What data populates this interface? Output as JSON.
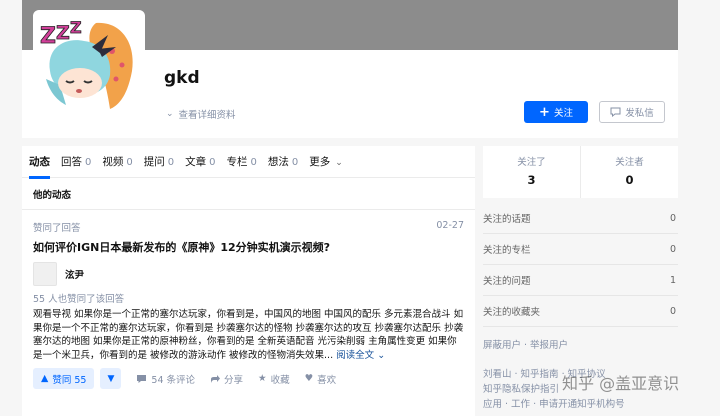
{
  "profile": {
    "name": "gkd",
    "view_details": "查看详细资料",
    "follow_label": "关注",
    "message_label": "发私信",
    "avatar_text": "ZZZ"
  },
  "tabs": [
    {
      "label": "动态",
      "count": ""
    },
    {
      "label": "回答",
      "count": "0"
    },
    {
      "label": "视频",
      "count": "0"
    },
    {
      "label": "提问",
      "count": "0"
    },
    {
      "label": "文章",
      "count": "0"
    },
    {
      "label": "专栏",
      "count": "0"
    },
    {
      "label": "想法",
      "count": "0"
    },
    {
      "label": "更多",
      "count": ""
    }
  ],
  "feed": {
    "section_title": "他的动态",
    "item": {
      "action": "赞同了回答",
      "date": "02-27",
      "title": "如何评价IGN日本最新发布的《原神》12分钟实机演示视频?",
      "author": "泫尹",
      "upvote_info": "55 人也赞同了该回答",
      "excerpt": "观看导视 如果你是一个正常的塞尔达玩家，你看到是，中国风的地图 中国风的配乐 多元素混合战斗 如果你是一个不正常的塞尔达玩家，你看到是 抄袭塞尔达的怪物 抄袭塞尔达的攻互 抄袭塞尔达配乐 抄袭塞尔达的地图 如果你是正常的原神粉丝，你看到的是 全新英语配音 光污染削弱 主角属性变更 如果你是一个米卫兵，你看到的是 被修改的游泳动作 被修改的怪物消失效果...",
      "read_more": "阅读全文",
      "vote_label": "赞同 55",
      "comments": "54 条评论",
      "share": "分享",
      "favorite": "收藏",
      "like": "喜欢"
    }
  },
  "stats": {
    "following_label": "关注了",
    "following_value": "3",
    "followers_label": "关注者",
    "followers_value": "0"
  },
  "side": [
    {
      "label": "关注的话题",
      "count": "0"
    },
    {
      "label": "关注的专栏",
      "count": "0"
    },
    {
      "label": "关注的问题",
      "count": "1"
    },
    {
      "label": "关注的收藏夹",
      "count": "0"
    }
  ],
  "side_link": "屏蔽用户 · 举报用户",
  "footer_lines": [
    "刘看山 · 知乎指南 · 知乎协议",
    "知乎隐私保护指引",
    "应用 · 工作 · 申请开通知乎机构号"
  ],
  "watermark": "知乎 @盖亚意识",
  "colors": {
    "accent": "#0066ff",
    "cover": "#8c8c8c",
    "muted": "#8590a6"
  }
}
